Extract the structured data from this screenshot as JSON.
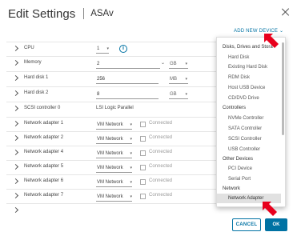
{
  "dialog": {
    "title": "Edit Settings",
    "subtitle": "ASAv",
    "add_device_label": "ADD NEW DEVICE",
    "add_device_chevron": "⌄"
  },
  "hardware": {
    "cpu": {
      "label": "CPU",
      "value": "1"
    },
    "memory": {
      "label": "Memory",
      "value": "2",
      "unit": "GB"
    },
    "hard_disk_1": {
      "label": "Hard disk 1",
      "value": "256",
      "unit": "MB"
    },
    "hard_disk_2": {
      "label": "Hard disk 2",
      "value": "8",
      "unit": "GB"
    },
    "scsi": {
      "label": "SCSI controller 0",
      "value": "LSI Logic Parallel"
    },
    "network_adapters": [
      {
        "label": "Network adapter 1",
        "network": "VM Network",
        "connected": "Connected"
      },
      {
        "label": "Network adapter 2",
        "network": "VM Network",
        "connected": "Connected"
      },
      {
        "label": "Network adapter 4",
        "network": "VM Network",
        "connected": "Connected"
      },
      {
        "label": "Network adapter 5",
        "network": "VM Network",
        "connected": "Connected"
      },
      {
        "label": "Network adapter 6",
        "network": "VM Network",
        "connected": "Connected"
      },
      {
        "label": "Network adapter 7",
        "network": "VM Network",
        "connected": "Connected"
      }
    ]
  },
  "menu": {
    "sections": [
      {
        "title": "Disks, Drives and Stora",
        "items": [
          "Hard Disk",
          "Existing Hard Disk",
          "RDM Disk",
          "Host USB Device",
          "CD/DVD Drive"
        ]
      },
      {
        "title": "Controllers",
        "items": [
          "NVMe Controller",
          "SATA Controller",
          "SCSI Controller",
          "USB Controller"
        ]
      },
      {
        "title": "Other Devices",
        "items": [
          "PCI Device",
          "Serial Port"
        ]
      },
      {
        "title": "Network",
        "items": [
          "Network Adapter"
        ]
      }
    ],
    "highlighted_item": "Network Adapter"
  },
  "footer": {
    "cancel_label": "CANCEL",
    "ok_label": "OK"
  },
  "colors": {
    "accent": "#0072a3",
    "annotation_arrow": "#e8001c",
    "menu_highlight": "#e1e1e1"
  },
  "icons": {
    "close": "close-icon",
    "info": "info-icon",
    "expand": "chevron-right-icon",
    "dropdown": "chevron-down-icon",
    "annotation": "red-arrow-icon"
  }
}
